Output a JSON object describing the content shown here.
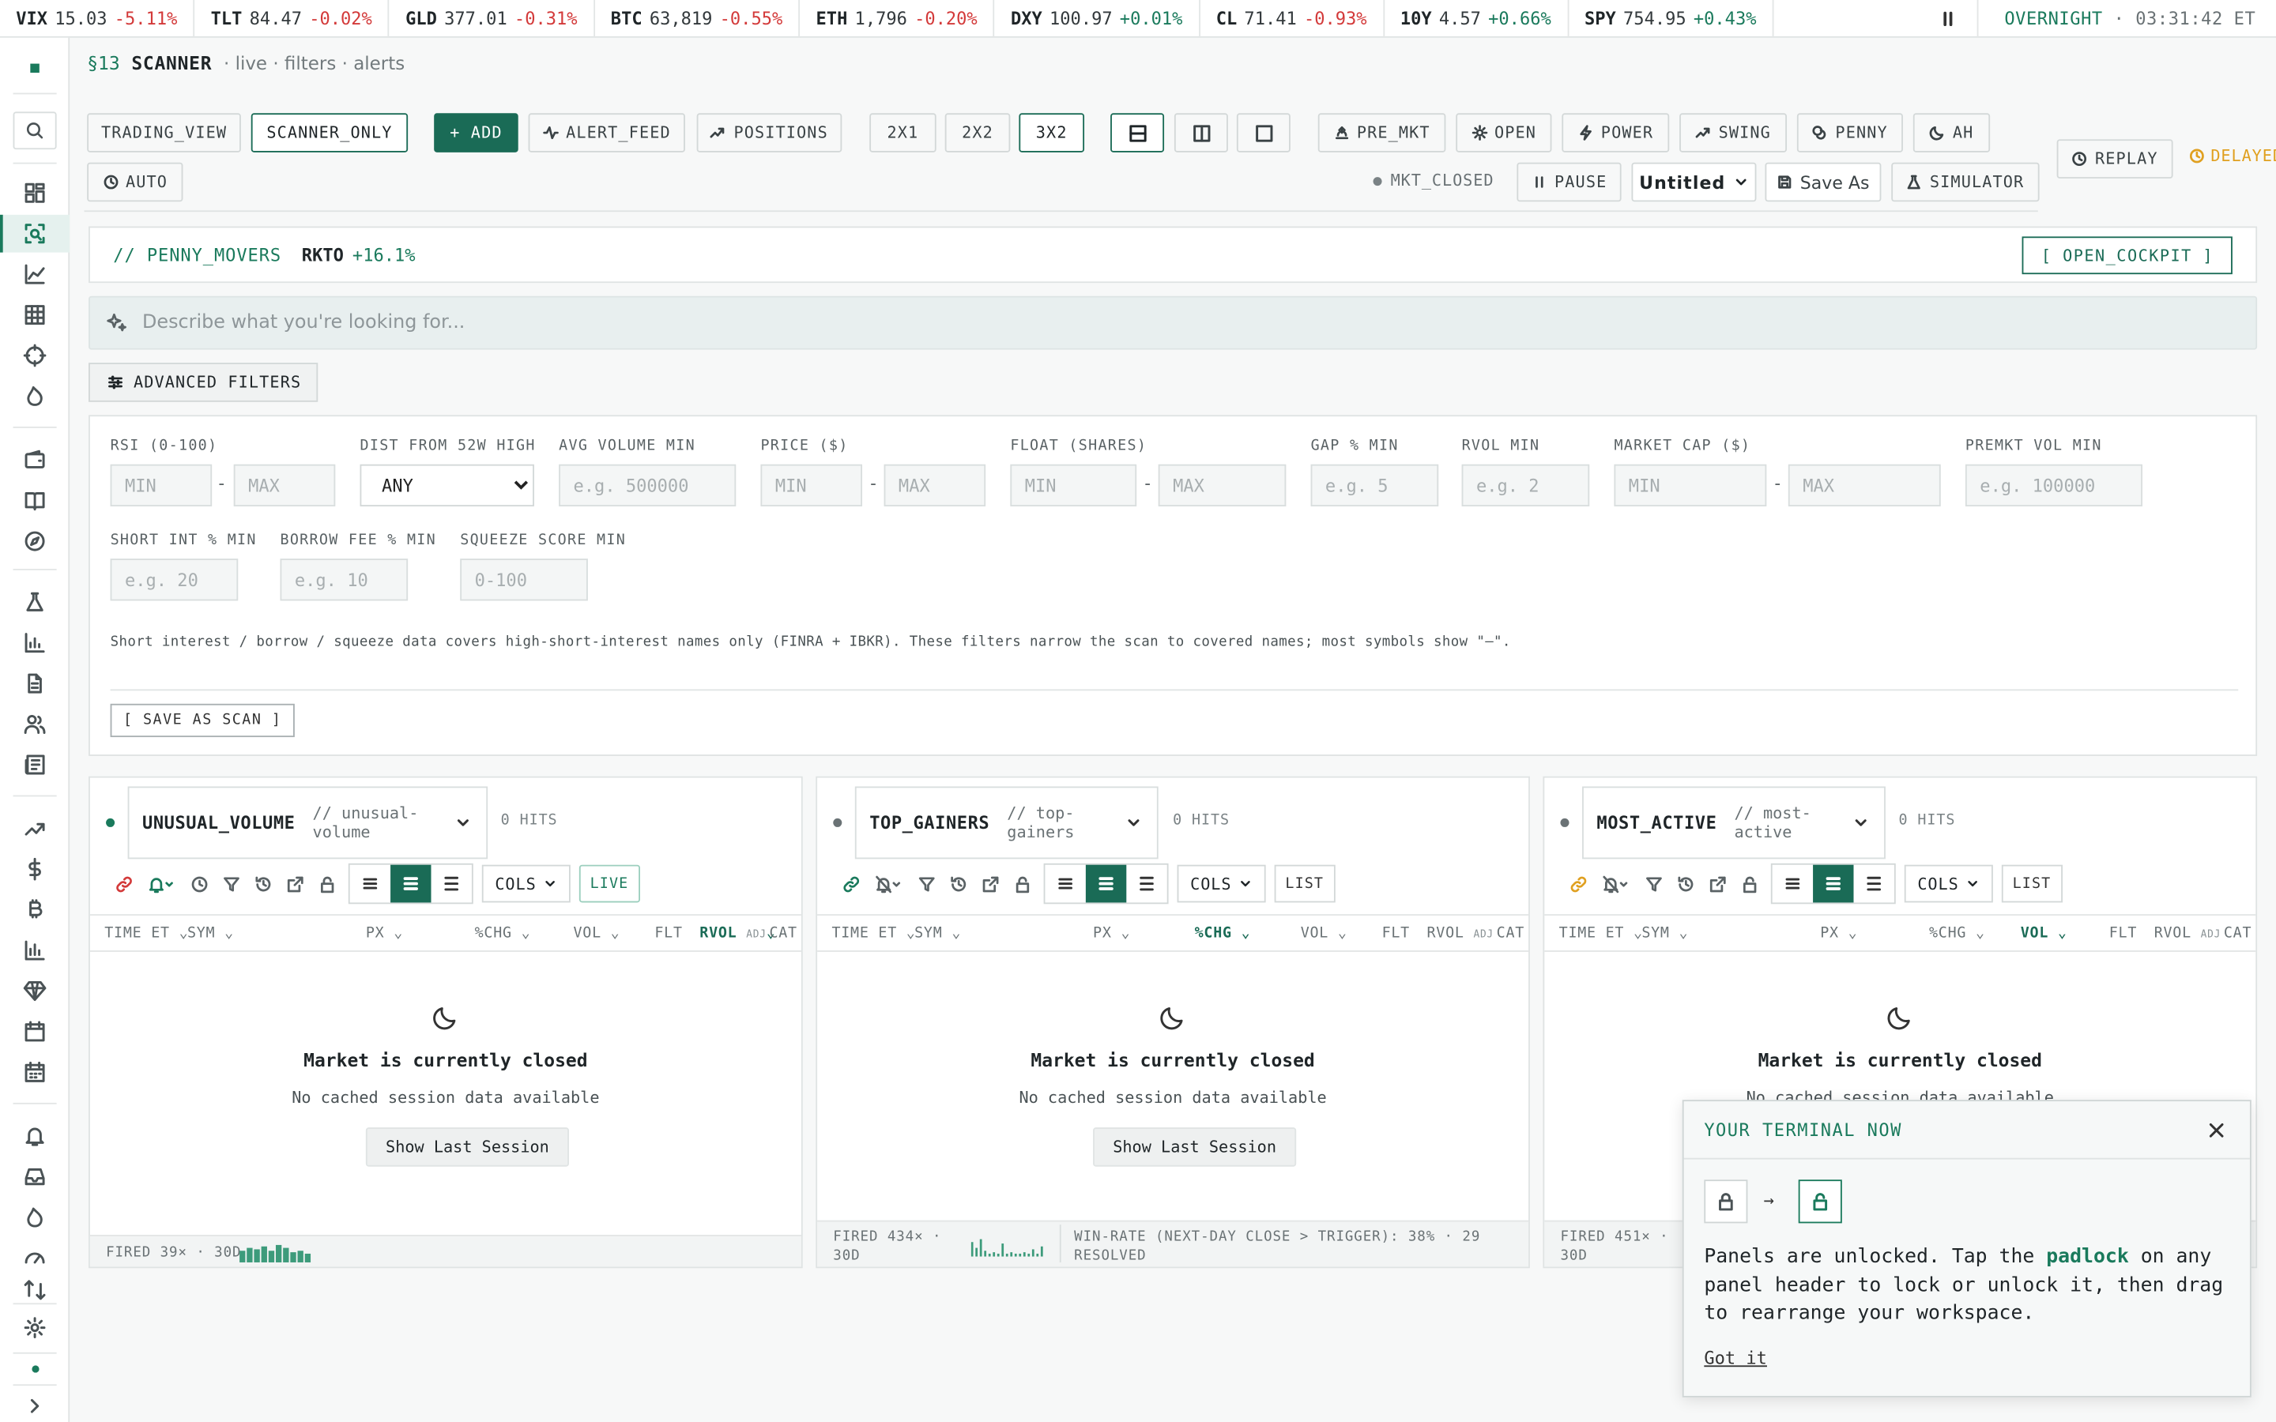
{
  "ticker": [
    {
      "sym": "VIX",
      "price": "15.03",
      "chg": "-5.11%",
      "dir": "down"
    },
    {
      "sym": "TLT",
      "price": "84.47",
      "chg": "-0.02%",
      "dir": "down"
    },
    {
      "sym": "GLD",
      "price": "377.01",
      "chg": "-0.31%",
      "dir": "down"
    },
    {
      "sym": "BTC",
      "price": "63,819",
      "chg": "-0.55%",
      "dir": "down"
    },
    {
      "sym": "ETH",
      "price": "1,796",
      "chg": "-0.20%",
      "dir": "down"
    },
    {
      "sym": "DXY",
      "price": "100.97",
      "chg": "+0.01%",
      "dir": "up"
    },
    {
      "sym": "CL",
      "price": "71.41",
      "chg": "-0.93%",
      "dir": "down"
    },
    {
      "sym": "10Y",
      "price": "4.57",
      "chg": "+0.66%",
      "dir": "up"
    },
    {
      "sym": "SPY",
      "price": "754.95",
      "chg": "+0.43%",
      "dir": "up"
    }
  ],
  "session": {
    "label": "OVERNIGHT",
    "time": "03:31:42 ET"
  },
  "header": {
    "section": "§13",
    "title": "SCANNER",
    "subtitle": "· live · filters · alerts"
  },
  "toolbar": {
    "trading_view": "TRADING_VIEW",
    "scanner_only": "SCANNER_ONLY",
    "add": "+ ADD",
    "alert_feed": "ALERT_FEED",
    "positions": "POSITIONS",
    "layout_2x1": "2X1",
    "layout_2x2": "2X2",
    "layout_3x2": "3X2",
    "pre_mkt": "PRE_MKT",
    "open": "OPEN",
    "power": "POWER",
    "swing": "SWING",
    "penny": "PENNY",
    "ah": "AH",
    "auto": "AUTO",
    "replay": "REPLAY",
    "delayed": "DELAYED",
    "mkt_status": "MKT_CLOSED",
    "pause": "PAUSE",
    "workspace": "Untitled",
    "save_as": "Save As",
    "simulator": "SIMULATOR"
  },
  "penny_movers": {
    "title": "// PENNY_MOVERS",
    "symbol": "RKTO",
    "change": "+16.1%",
    "cockpit": "[ OPEN_COCKPIT ]"
  },
  "search": {
    "placeholder": "Describe what you're looking for..."
  },
  "advanced_filters": {
    "button": "ADVANCED FILTERS",
    "rsi": {
      "label": "RSI (0-100)",
      "min": "MIN",
      "max": "MAX"
    },
    "dist52": {
      "label": "DIST FROM 52W HIGH",
      "value": "ANY"
    },
    "avgvol": {
      "label": "AVG VOLUME MIN",
      "placeholder": "e.g. 500000"
    },
    "price": {
      "label": "PRICE ($)",
      "min": "MIN",
      "max": "MAX"
    },
    "float": {
      "label": "FLOAT (SHARES)",
      "min": "MIN",
      "max": "MAX"
    },
    "gap": {
      "label": "GAP % MIN",
      "placeholder": "e.g. 5"
    },
    "rvol": {
      "label": "RVOL MIN",
      "placeholder": "e.g. 2"
    },
    "mcap": {
      "label": "MARKET CAP ($)",
      "min": "MIN",
      "max": "MAX"
    },
    "premkt": {
      "label": "PREMKT VOL MIN",
      "placeholder": "e.g. 100000"
    },
    "shortint": {
      "label": "SHORT INT % MIN",
      "placeholder": "e.g. 20"
    },
    "borrow": {
      "label": "BORROW FEE % MIN",
      "placeholder": "e.g. 10"
    },
    "squeeze": {
      "label": "SQUEEZE SCORE MIN",
      "placeholder": "0-100"
    },
    "note": "Short interest / borrow / squeeze data covers high-short-interest names only (FINRA + IBKR). These filters narrow the scan to covered names; most symbols show \"—\".",
    "save": "[ SAVE AS SCAN ]"
  },
  "columns": {
    "time": "TIME ET",
    "sym": "SYM",
    "px": "PX",
    "chg": "%CHG",
    "vol": "VOL",
    "flt": "FLT",
    "rvol": "RVOL",
    "adj": "ADJ",
    "cat": "CAT"
  },
  "panels": [
    {
      "name": "UNUSUAL_VOLUME",
      "slug": "// unusual-volume",
      "hits": "0 HITS",
      "mode": "LIVE",
      "dot": "#1a7a5c",
      "footer": "FIRED 39× · 30D",
      "winrate": "",
      "sort": "rvol"
    },
    {
      "name": "TOP_GAINERS",
      "slug": "// top-gainers",
      "hits": "0 HITS",
      "mode": "LIST",
      "dot": "#6a7275",
      "footer": "FIRED 434× · 30D",
      "winrate": "WIN-RATE (NEXT-DAY CLOSE > TRIGGER): 38% · 29 RESOLVED",
      "sort": "chg"
    },
    {
      "name": "MOST_ACTIVE",
      "slug": "// most-active",
      "hits": "0 HITS",
      "mode": "LIST",
      "dot": "#6a7275",
      "footer": "FIRED 451× · 30D",
      "winrate": "",
      "sort": "vol"
    }
  ],
  "empty_state": {
    "title": "Market is currently closed",
    "subtitle": "No cached session data available",
    "button": "Show Last Session"
  },
  "cols_label": "COLS",
  "popup": {
    "title": "YOUR TERMINAL NOW",
    "message_a": "Panels are unlocked. Tap the ",
    "message_b": "padlock",
    "message_c": " on any panel header to lock or unlock it, then drag to rearrange your workspace.",
    "dismiss": "Got it"
  }
}
